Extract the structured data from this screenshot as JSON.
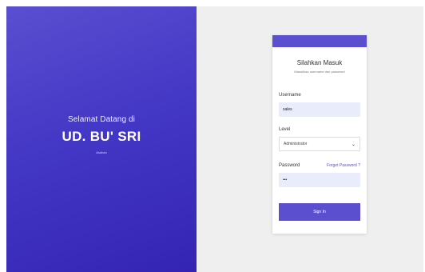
{
  "left": {
    "welcome": "Selamat Datang di",
    "company": "UD. BU' SRI",
    "location": "Asahan"
  },
  "card": {
    "title": "Silahkan Masuk",
    "subtitle": "Masukkan username dan password",
    "username": {
      "label": "Username",
      "value": "sales"
    },
    "level": {
      "label": "Level",
      "selected": "Administrator"
    },
    "password": {
      "label": "Password",
      "value": "•••",
      "forgot": "Forget Password ?"
    },
    "signin": "Sign In"
  },
  "colors": {
    "accent": "#5b4fcf",
    "gradient_start": "#5a4fd0",
    "gradient_end": "#3524b4",
    "input_bg": "#e8ecfb",
    "page_bg": "#efefef"
  },
  "icons": {
    "select_arrow": "chevron-down-icon"
  }
}
